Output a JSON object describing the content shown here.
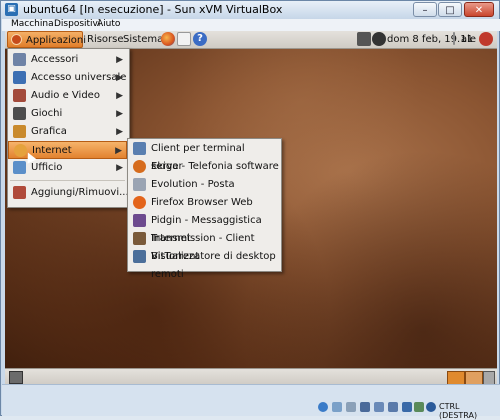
{
  "window": {
    "title": "ubuntu64 [In esecuzione] - Sun xVM VirtualBox",
    "minimize": "–",
    "maximize": "□",
    "close": "✕"
  },
  "menubar": {
    "items": [
      "Macchina",
      "Dispositivi",
      "Aiuto"
    ]
  },
  "panel": {
    "applicazioni": "Applicazioni",
    "risorse": "Risorse",
    "sistema": "Sistema",
    "clock": "dom 8 feb, 19.11",
    "user": "ale"
  },
  "apps_menu": {
    "items": [
      {
        "label": "Accessori",
        "icon": "accessories-icon",
        "color": "#6f83a6"
      },
      {
        "label": "Accesso universale",
        "icon": "universal-access-icon",
        "color": "#3d6fb3"
      },
      {
        "label": "Audio e Video",
        "icon": "multimedia-icon",
        "color": "#a34a3a"
      },
      {
        "label": "Giochi",
        "icon": "games-icon",
        "color": "#4d4d4d"
      },
      {
        "label": "Grafica",
        "icon": "graphics-icon",
        "color": "#c98a2c"
      },
      {
        "label": "Internet",
        "icon": "internet-icon",
        "color": "#e5a23d"
      },
      {
        "label": "Ufficio",
        "icon": "office-icon",
        "color": "#5b8fc9"
      }
    ],
    "extra": {
      "label": "Aggiungi/Rimuovi...",
      "icon": "add-remove-icon",
      "color": "#b04a3a"
    }
  },
  "internet_submenu": {
    "items": [
      {
        "label": "Client per terminal server",
        "icon": "terminal-server-icon",
        "color": "#5a7fb0"
      },
      {
        "label": "Ekiga - Telefonia software",
        "icon": "ekiga-icon",
        "color": "#d66c1d"
      },
      {
        "label": "Evolution - Posta",
        "icon": "evolution-icon",
        "color": "#9aa4b3"
      },
      {
        "label": "Firefox Browser Web",
        "icon": "firefox-icon",
        "color": "#e3641b"
      },
      {
        "label": "Pidgin - Messaggistica Internet",
        "icon": "pidgin-icon",
        "color": "#6d4a8e"
      },
      {
        "label": "Transmission - Client BitTorrent",
        "icon": "transmission-icon",
        "color": "#7a5a3a"
      },
      {
        "label": "Visualizzatore di desktop remoti",
        "icon": "remote-desktop-icon",
        "color": "#4c6f9a"
      }
    ]
  },
  "statusbar": {
    "host_key": "CTRL (DESTRA)"
  }
}
